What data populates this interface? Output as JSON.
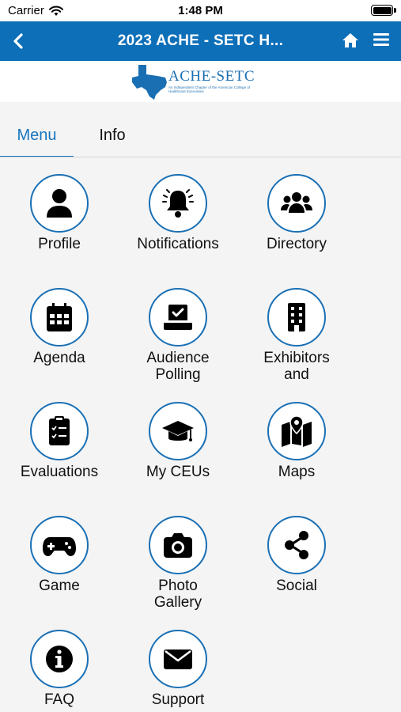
{
  "status_bar": {
    "carrier": "Carrier",
    "time": "1:48 PM"
  },
  "nav": {
    "title": "2023 ACHE - SETC H..."
  },
  "logo": {
    "name": "ACHE-SETC",
    "subtitle": "An Independent Chapter of the American College of Healthcare Executives"
  },
  "tabs": [
    {
      "label": "Menu",
      "active": true
    },
    {
      "label": "Info",
      "active": false
    }
  ],
  "accent_color": "#0d6fb8",
  "tiles": [
    {
      "label": "Profile",
      "icon": "user-icon"
    },
    {
      "label": "Notifications",
      "icon": "bell-icon"
    },
    {
      "label": "Directory",
      "icon": "users-icon"
    },
    {
      "label": "Agenda",
      "icon": "calendar-icon"
    },
    {
      "label": "Audience\nPolling",
      "icon": "ballot-box-icon"
    },
    {
      "label": "Exhibitors\nand",
      "icon": "building-icon"
    },
    {
      "label": "Evaluations",
      "icon": "clipboard-icon"
    },
    {
      "label": "My CEUs",
      "icon": "graduation-cap-icon"
    },
    {
      "label": "Maps",
      "icon": "map-icon"
    },
    {
      "label": "Game",
      "icon": "gamepad-icon"
    },
    {
      "label": "Photo\nGallery",
      "icon": "camera-icon"
    },
    {
      "label": "Social",
      "icon": "share-icon"
    },
    {
      "label": "FAQ",
      "icon": "info-icon"
    },
    {
      "label": "Support",
      "icon": "envelope-icon"
    }
  ]
}
